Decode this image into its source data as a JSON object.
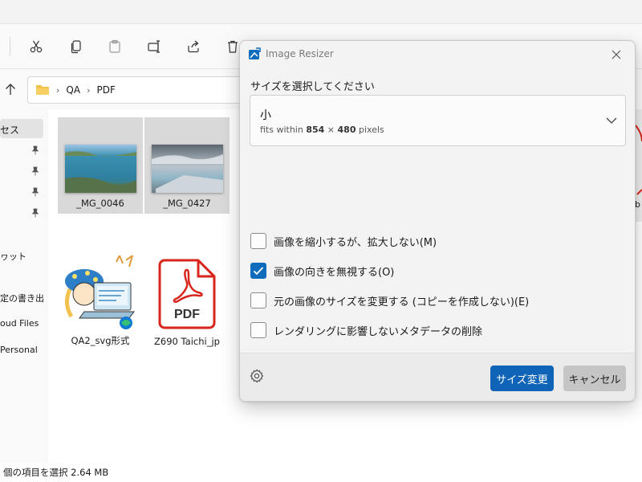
{
  "explorer": {
    "breadcrumb": [
      "QA",
      "PDF"
    ],
    "nav_items": [
      "セス",
      "ヮット",
      "定の書き出",
      "oud Files",
      "Personal"
    ],
    "files": [
      {
        "name": "_MG_0046",
        "kind": "photo-sea"
      },
      {
        "name": "_MG_0427",
        "kind": "photo-sky"
      },
      {
        "name": "QA2_svg形式",
        "kind": "illustration"
      },
      {
        "name": "Z690 Taichi_jp",
        "kind": "pdf",
        "pdf_label": "PDF"
      }
    ],
    "right_edge_text": "b",
    "status_text": "個の項目を選択  2.64 MB"
  },
  "dialog": {
    "title": "Image Resizer",
    "size_label": "サイズを選択してください",
    "size_option": {
      "name": "小",
      "desc_prefix": "fits within ",
      "width": "854",
      "times": " × ",
      "height": "480",
      "unit": " pixels"
    },
    "options": [
      {
        "label": "画像を縮小するが、拡大しない(M)",
        "checked": false
      },
      {
        "label": "画像の向きを無視する(O)",
        "checked": true
      },
      {
        "label": "元の画像のサイズを変更する (コピーを作成しない)(E)",
        "checked": false
      },
      {
        "label": "レンダリングに影響しないメタデータの削除",
        "checked": false
      }
    ],
    "resize_button": "サイズ変更",
    "cancel_button": "キャンセル"
  },
  "colors": {
    "accent": "#1064b8",
    "checkbox_checked": "#0f6cbd",
    "pdf_red": "#d9261c"
  }
}
